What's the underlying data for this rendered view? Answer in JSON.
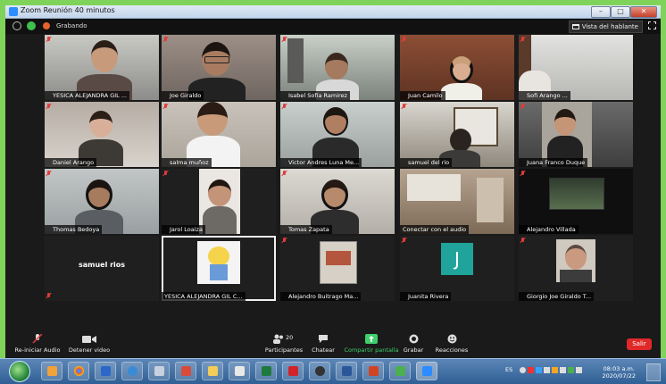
{
  "window": {
    "title": "Zoom Reunión 40 minutos",
    "min": "–",
    "max": "□",
    "close": "✕"
  },
  "topbar": {
    "recording": "Grabando",
    "speaker_view": "Vista del hablante"
  },
  "participants": [
    {
      "name": "YESICA ALEJANDRA GIL ..."
    },
    {
      "name": "Joe Giraldo"
    },
    {
      "name": "Isabel Sofía Ramirez"
    },
    {
      "name": "Juan Camilo"
    },
    {
      "name": "Sofi Arango ..."
    },
    {
      "name": "Daniel Arango"
    },
    {
      "name": "salma muñoz"
    },
    {
      "name": "Victor Andres Luna Me..."
    },
    {
      "name": "samuel del rio"
    },
    {
      "name": "Juana Franco Duque"
    },
    {
      "name": "Thomas Bedoya"
    },
    {
      "name": "Jarol Loaiza"
    },
    {
      "name": "Tomas Zapata"
    },
    {
      "name": "Conectar con el audio"
    },
    {
      "name": "Alejandro Villada"
    },
    {
      "name": "samuel rios",
      "display": "samuel rios"
    },
    {
      "name": "YESICA ALEJANDRA GIL C..."
    },
    {
      "name": "Alejandro Buitrago Ma..."
    },
    {
      "name": "Juanita Rivera",
      "avatar_letter": "J"
    },
    {
      "name": "Giorgio Joe Giraldo T..."
    }
  ],
  "toolbar": {
    "audio": "Re-iniciar Audio",
    "video": "Detener video",
    "participants": "Participantes",
    "participants_count": "20",
    "chat": "Chatear",
    "share": "Compartir pantalla",
    "record": "Grabar",
    "reactions": "Reacciones",
    "leave": "Salir"
  },
  "taskbar": {
    "time": "08:03 a.m.",
    "date": "2020/07/22",
    "lang": "ES"
  },
  "colors": {
    "accent_green": "#3ecf6b",
    "leave_red": "#e02828",
    "juanita_tile": "#1fa39a",
    "border_green": "#7fd35a"
  }
}
